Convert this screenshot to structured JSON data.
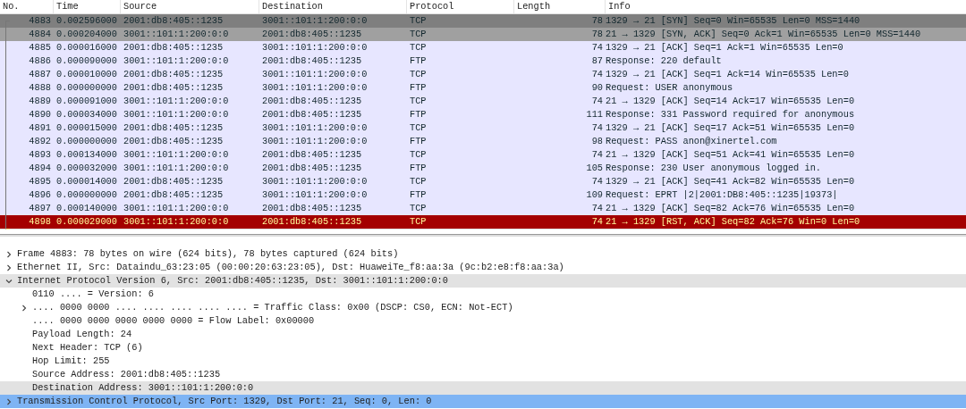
{
  "packet_list": {
    "columns": [
      "No.",
      "Time",
      "Source",
      "Destination",
      "Protocol",
      "Length",
      "Info"
    ],
    "rows": [
      {
        "no": "4883",
        "time": "0.002596000",
        "source": "2001:db8:405::1235",
        "destination": "3001::101:1:200:0:0",
        "protocol": "TCP",
        "length": "78",
        "info": "1329 → 21 [SYN] Seq=0 Win=65535 Len=0 MSS=1440",
        "kind": "syn-fin",
        "selected": true
      },
      {
        "no": "4884",
        "time": "0.000204000",
        "source": "3001::101:1:200:0:0",
        "destination": "2001:db8:405::1235",
        "protocol": "TCP",
        "length": "78",
        "info": "21 → 1329 [SYN, ACK] Seq=0 Ack=1 Win=65535 Len=0 MSS=1440",
        "kind": "syn-fin",
        "selected": false
      },
      {
        "no": "4885",
        "time": "0.000016000",
        "source": "2001:db8:405::1235",
        "destination": "3001::101:1:200:0:0",
        "protocol": "TCP",
        "length": "74",
        "info": "1329 → 21 [ACK] Seq=1 Ack=1 Win=65535 Len=0",
        "kind": "tcp",
        "selected": false
      },
      {
        "no": "4886",
        "time": "0.000090000",
        "source": "3001::101:1:200:0:0",
        "destination": "2001:db8:405::1235",
        "protocol": "FTP",
        "length": "87",
        "info": "Response: 220 default",
        "kind": "tcp",
        "selected": false
      },
      {
        "no": "4887",
        "time": "0.000010000",
        "source": "2001:db8:405::1235",
        "destination": "3001::101:1:200:0:0",
        "protocol": "TCP",
        "length": "74",
        "info": "1329 → 21 [ACK] Seq=1 Ack=14 Win=65535 Len=0",
        "kind": "tcp",
        "selected": false
      },
      {
        "no": "4888",
        "time": "0.000000000",
        "source": "2001:db8:405::1235",
        "destination": "3001::101:1:200:0:0",
        "protocol": "FTP",
        "length": "90",
        "info": "Request: USER anonymous",
        "kind": "tcp",
        "selected": false
      },
      {
        "no": "4889",
        "time": "0.000091000",
        "source": "3001::101:1:200:0:0",
        "destination": "2001:db8:405::1235",
        "protocol": "TCP",
        "length": "74",
        "info": "21 → 1329 [ACK] Seq=14 Ack=17 Win=65535 Len=0",
        "kind": "tcp",
        "selected": false
      },
      {
        "no": "4890",
        "time": "0.000034000",
        "source": "3001::101:1:200:0:0",
        "destination": "2001:db8:405::1235",
        "protocol": "FTP",
        "length": "111",
        "info": "Response: 331 Password required for anonymous",
        "kind": "tcp",
        "selected": false
      },
      {
        "no": "4891",
        "time": "0.000015000",
        "source": "2001:db8:405::1235",
        "destination": "3001::101:1:200:0:0",
        "protocol": "TCP",
        "length": "74",
        "info": "1329 → 21 [ACK] Seq=17 Ack=51 Win=65535 Len=0",
        "kind": "tcp",
        "selected": false
      },
      {
        "no": "4892",
        "time": "0.000000000",
        "source": "2001:db8:405::1235",
        "destination": "3001::101:1:200:0:0",
        "protocol": "FTP",
        "length": "98",
        "info": "Request: PASS anon@xinertel.com",
        "kind": "tcp",
        "selected": false
      },
      {
        "no": "4893",
        "time": "0.000134000",
        "source": "3001::101:1:200:0:0",
        "destination": "2001:db8:405::1235",
        "protocol": "TCP",
        "length": "74",
        "info": "21 → 1329 [ACK] Seq=51 Ack=41 Win=65535 Len=0",
        "kind": "tcp",
        "selected": false
      },
      {
        "no": "4894",
        "time": "0.000032000",
        "source": "3001::101:1:200:0:0",
        "destination": "2001:db8:405::1235",
        "protocol": "FTP",
        "length": "105",
        "info": "Response: 230 User anonymous logged in.",
        "kind": "tcp",
        "selected": false
      },
      {
        "no": "4895",
        "time": "0.000014000",
        "source": "2001:db8:405::1235",
        "destination": "3001::101:1:200:0:0",
        "protocol": "TCP",
        "length": "74",
        "info": "1329 → 21 [ACK] Seq=41 Ack=82 Win=65535 Len=0",
        "kind": "tcp",
        "selected": false
      },
      {
        "no": "4896",
        "time": "0.000000000",
        "source": "2001:db8:405::1235",
        "destination": "3001::101:1:200:0:0",
        "protocol": "FTP",
        "length": "109",
        "info": "Request: EPRT |2|2001:DB8:405::1235|19373|",
        "kind": "tcp",
        "selected": false
      },
      {
        "no": "4897",
        "time": "0.000140000",
        "source": "3001::101:1:200:0:0",
        "destination": "2001:db8:405::1235",
        "protocol": "TCP",
        "length": "74",
        "info": "21 → 1329 [ACK] Seq=82 Ack=76 Win=65535 Len=0",
        "kind": "tcp",
        "selected": false
      },
      {
        "no": "4898",
        "time": "0.000029000",
        "source": "3001::101:1:200:0:0",
        "destination": "2001:db8:405::1235",
        "protocol": "TCP",
        "length": "74",
        "info": "21 → 1329 [RST, ACK] Seq=82 Ack=76 Win=0 Len=0",
        "kind": "tcp-rst",
        "selected": false
      }
    ]
  },
  "packet_details": [
    {
      "label": "Frame 4883: 78 bytes on wire (624 bits), 78 bytes captured (624 bits)",
      "expanded": false,
      "selected": false,
      "highlighted": false
    },
    {
      "label": "Ethernet II, Src: Dataindu_63:23:05 (00:00:20:63:23:05), Dst: HuaweiTe_f8:aa:3a (9c:b2:e8:f8:aa:3a)",
      "expanded": false,
      "selected": false,
      "highlighted": false
    },
    {
      "label": "Internet Protocol Version 6, Src: 2001:db8:405::1235, Dst: 3001::101:1:200:0:0",
      "expanded": true,
      "selected": false,
      "highlighted": true,
      "children": [
        {
          "label": "0110 .... = Version: 6",
          "selected": false,
          "highlighted": false
        },
        {
          "label": ".... 0000 0000 .... .... .... .... .... = Traffic Class: 0x00 (DSCP: CS0, ECN: Not-ECT)",
          "expanded": false,
          "selected": false,
          "highlighted": false
        },
        {
          "label": ".... 0000 0000 0000 0000 0000 = Flow Label: 0x00000",
          "selected": false,
          "highlighted": false
        },
        {
          "label": "Payload Length: 24",
          "selected": false,
          "highlighted": false
        },
        {
          "label": "Next Header: TCP (6)",
          "selected": false,
          "highlighted": false
        },
        {
          "label": "Hop Limit: 255",
          "selected": false,
          "highlighted": false
        },
        {
          "label": "Source Address: 2001:db8:405::1235",
          "selected": false,
          "highlighted": false
        },
        {
          "label": "Destination Address: 3001::101:1:200:0:0",
          "selected": false,
          "highlighted": true
        }
      ]
    },
    {
      "label": "Transmission Control Protocol, Src Port: 1329, Dst Port: 21, Seq: 0, Len: 0",
      "expanded": false,
      "selected": true,
      "highlighted": false
    }
  ]
}
